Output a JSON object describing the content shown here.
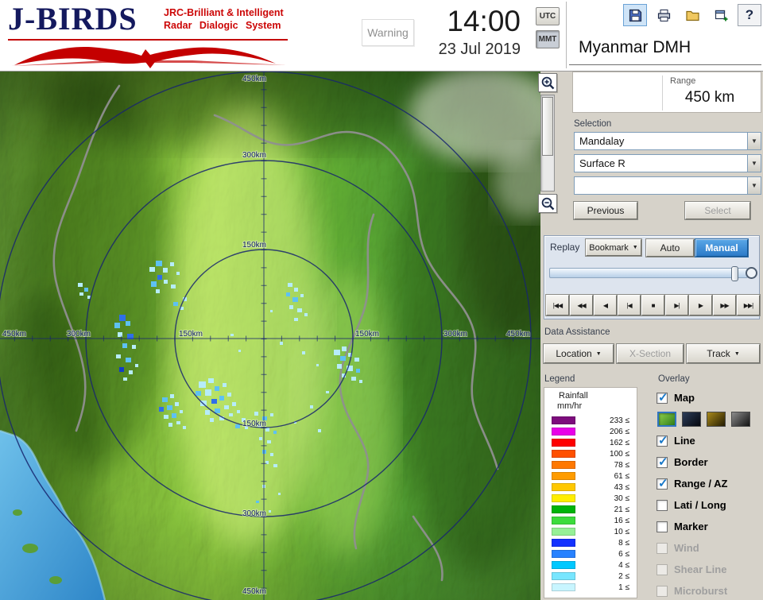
{
  "header": {
    "logo": {
      "title": "J-BIRDS",
      "subtitle1": "JRC-Brilliant & Intelligent",
      "subtitle2": "Radar Dialogic System"
    },
    "warning_label": "Warning",
    "time": "14:00",
    "date": "23 Jul 2019",
    "timezone": {
      "utc": "UTC",
      "mmt": "MMT",
      "selected": "MMT"
    },
    "help_label": "?",
    "station_name": "Myanmar DMH",
    "icons": [
      "save-icon",
      "printer-icon",
      "folder-icon",
      "export-icon",
      "help-icon",
      "zoom-in-icon",
      "zoom-out-icon"
    ]
  },
  "map": {
    "rings_km": [
      150,
      300,
      450
    ],
    "ring_labels": {
      "r150": "150km",
      "r300": "300km",
      "r450": "450km"
    }
  },
  "panel": {
    "range": {
      "label": "Range",
      "value": "450 km"
    },
    "selection": {
      "label": "Selection",
      "site": "Mandalay",
      "product": "Surface R",
      "extra": ""
    },
    "previous_button": "Previous",
    "select_button": "Select",
    "replay": {
      "title": "Replay",
      "bookmark_button": "Bookmark",
      "auto_button": "Auto",
      "manual_button": "Manual",
      "mode_selected": "Manual",
      "playback": [
        "|◀◀",
        "◀◀",
        "◀",
        "|◀",
        "■",
        "▶|",
        "▶",
        "▶▶",
        "▶▶|"
      ]
    },
    "data_assistance": {
      "title": "Data Assistance",
      "location_button": "Location",
      "xsection_button": "X-Section",
      "track_button": "Track"
    },
    "legend": {
      "title": "Legend",
      "quantity": "Rainfall",
      "unit": "mm/hr",
      "levels": [
        {
          "value": "233 ≤",
          "color": "#7d0d7d"
        },
        {
          "value": "206 ≤",
          "color": "#e800e8"
        },
        {
          "value": "162 ≤",
          "color": "#ff0000"
        },
        {
          "value": "100 ≤",
          "color": "#ff5000"
        },
        {
          "value": "78 ≤",
          "color": "#ff7800"
        },
        {
          "value": "61 ≤",
          "color": "#ff9c00"
        },
        {
          "value": "43 ≤",
          "color": "#ffc800"
        },
        {
          "value": "30 ≤",
          "color": "#ffee00"
        },
        {
          "value": "21 ≤",
          "color": "#00b40a"
        },
        {
          "value": "16 ≤",
          "color": "#3cdc3c"
        },
        {
          "value": "10 ≤",
          "color": "#96f096"
        },
        {
          "value": "8 ≤",
          "color": "#1432ff"
        },
        {
          "value": "6 ≤",
          "color": "#2882ff"
        },
        {
          "value": "4 ≤",
          "color": "#00c8ff"
        },
        {
          "value": "2 ≤",
          "color": "#78e6ff"
        },
        {
          "value": "1 ≤",
          "color": "#c8f5ff"
        }
      ]
    },
    "overlay": {
      "title": "Overlay",
      "items": [
        {
          "label": "Map",
          "checked": true,
          "enabled": true
        },
        {
          "label": "Line",
          "checked": true,
          "enabled": true
        },
        {
          "label": "Border",
          "checked": true,
          "enabled": true
        },
        {
          "label": "Range / AZ",
          "checked": true,
          "enabled": true
        },
        {
          "label": "Lati / Long",
          "checked": false,
          "enabled": true
        },
        {
          "label": "Marker",
          "checked": false,
          "enabled": true
        },
        {
          "label": "Wind",
          "checked": false,
          "enabled": false
        },
        {
          "label": "Shear Line",
          "checked": false,
          "enabled": false
        },
        {
          "label": "Microburst",
          "checked": false,
          "enabled": false
        }
      ],
      "map_styles": [
        "green",
        "navy",
        "olive",
        "dark"
      ],
      "map_style_selected": "green"
    }
  }
}
